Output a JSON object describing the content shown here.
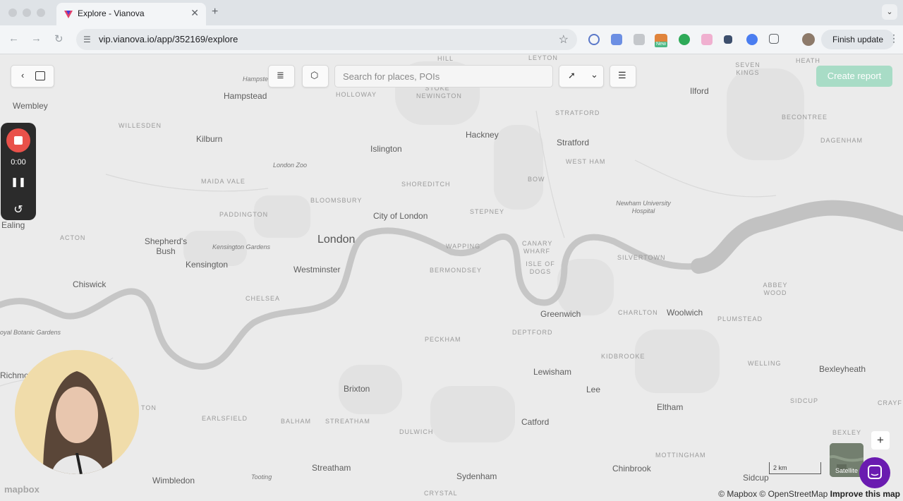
{
  "browser": {
    "tab_title": "Explore - Vianova",
    "url": "vip.vianova.io/app/352169/explore",
    "finish_update": "Finish update",
    "new_badge": "New"
  },
  "controls": {
    "search_placeholder": "Search for places, POIs",
    "create_report": "Create report"
  },
  "recorder": {
    "time": "0:00"
  },
  "map": {
    "places": {
      "london": "London",
      "westminster": "Westminster",
      "city_of_london": "City of London",
      "islington": "Islington",
      "hackney": "Hackney",
      "stratford": "Stratford",
      "ilford": "Ilford",
      "hampstead": "Hampstead",
      "hampstead_ital": "Hampstead",
      "wembley": "Wembley",
      "kilburn": "Kilburn",
      "willesden": "WILLESDEN",
      "maida_vale": "MAIDA VALE",
      "paddington": "PADDINGTON",
      "london_zoo": "London Zoo",
      "bloomsbury": "BLOOMSBURY",
      "shoreditch": "SHOREDITCH",
      "stepney": "STEPNEY",
      "bow": "BOW",
      "west_ham": "WEST HAM",
      "stratford_small": "STRATFORD",
      "holloway": "HOLLOWAY",
      "stoke_newington": "STOKE NEWINGTON",
      "hill": "HILL",
      "leyton": "LEYTON",
      "seven_kings": "SEVEN KINGS",
      "heath": "HEATH",
      "becontree": "BECONTREE",
      "dagenham": "DAGENHAM",
      "newham_hospital": "Newham University Hospital",
      "wapping": "WAPPING",
      "canary_wharf": "CANARY WHARF",
      "isle_of_dogs": "ISLE OF DOGS",
      "silvertown": "SILVERTOWN",
      "bermondsey": "BERMONDSEY",
      "greenwich": "Greenwich",
      "charlton": "CHARLTON",
      "woolwich": "Woolwich",
      "plumstead": "PLUMSTEAD",
      "abbey_wood": "ABBEY WOOD",
      "acton": "ACTON",
      "shepherds_bush": "Shepherd's Bush",
      "kensington_gardens": "Kensington Gardens",
      "kensington": "Kensington",
      "chiswick": "Chiswick",
      "chelsea": "CHELSEA",
      "ealing": "Ealing",
      "royal_botanic": "oyal Botanic Gardens",
      "richmond": "Richmo",
      "deptford": "DEPTFORD",
      "peckham": "PECKHAM",
      "kidbrooke": "KIDBROOKE",
      "welling": "WELLING",
      "bexleyheath": "Bexleyheath",
      "lewisham": "Lewisham",
      "lee": "Lee",
      "brixton": "Brixton",
      "eltham": "Eltham",
      "sidcup": "SIDCUP",
      "crayford": "CRAYF",
      "earlsfield": "EARLSFIELD",
      "balham": "BALHAM",
      "streatham_small": "STREATHAM",
      "dulwich": "DULWICH",
      "catford": "Catford",
      "bexley": "BEXLEY",
      "streatham": "Streatham",
      "tooting": "Tooting",
      "sydenham": "Sydenham",
      "chinbrook": "Chinbrook",
      "mottingham": "MOTTINGHAM",
      "wimbledon": "Wimbledon",
      "sidcup2": "Sidcup",
      "crystal": "CRYSTAL",
      "ton": "TON"
    },
    "scale_label": "2 km",
    "satellite_label": "Satellite",
    "mapbox": "mapbox",
    "attribution_1": "© Mapbox © OpenStreetMap",
    "attribution_2": "Improve this map"
  },
  "colors": {
    "accent": "#a8dcc6",
    "record_red": "#e9514a",
    "chat_purple": "#6a1bb0",
    "river": "#bfbfbf"
  }
}
